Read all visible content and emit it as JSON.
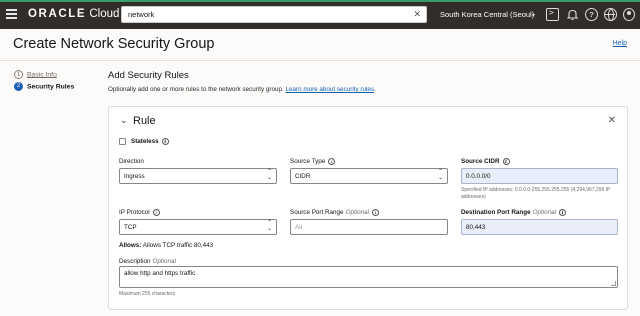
{
  "topbar": {
    "brand_oracle": "ORACLE",
    "brand_cloud": "Cloud",
    "search_value": "network",
    "region": "South Korea Central (Seoul)"
  },
  "page": {
    "title": "Create Network Security Group",
    "help_label": "Help"
  },
  "steps": [
    {
      "number": "1",
      "label": "Basic Info"
    },
    {
      "number": "2",
      "label": "Security Rules"
    }
  ],
  "section": {
    "title": "Add Security Rules",
    "description": "Optionally add one or more rules to the network security group.",
    "learn_more": "Learn more about security rules"
  },
  "rule": {
    "title": "Rule",
    "stateless_label": "Stateless",
    "direction": {
      "label": "Direction",
      "value": "Ingress"
    },
    "source_type": {
      "label": "Source Type",
      "value": "CIDR"
    },
    "source_cidr": {
      "label": "Source CIDR",
      "value": "0.0.0.0/0",
      "helper": "Specified IP addresses: 0.0.0.0-255.255.255.255 (4,294,967,296 IP addresses)"
    },
    "ip_protocol": {
      "label": "IP Protocol",
      "value": "TCP"
    },
    "source_port_range": {
      "label": "Source Port Range",
      "optional": "Optional",
      "placeholder": "All"
    },
    "destination_port_range": {
      "label": "Destination Port Range",
      "optional": "Optional",
      "value": "80,443"
    },
    "allows_label": "Allows:",
    "allows_text": "Allows TCP traffic 80,443",
    "description": {
      "label": "Description",
      "optional": "Optional",
      "value": "allow http and https traffic",
      "helper": "Maximum 255 characters"
    }
  }
}
